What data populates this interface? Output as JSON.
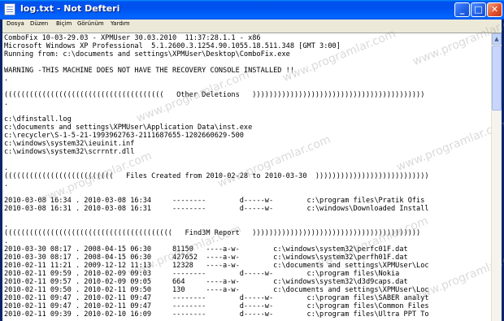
{
  "window": {
    "title": "log.txt - Not Defteri",
    "buttons": {
      "minimize": "_",
      "maximize": "□",
      "close": "✕"
    }
  },
  "menu": [
    "Dosya",
    "Düzen",
    "Biçim",
    "Görünüm",
    "Yardım"
  ],
  "watermark": "www.programlar.com",
  "lines": [
    "ComboFix 10-03-29.03 - XPMUser 30.03.2010  11:37:28.1.1 - x86",
    "Microsoft Windows XP Professional  5.1.2600.3.1254.90.1055.18.511.348 [GMT 3:00]",
    "Running from: c:\\documents and settings\\XPMUser\\Desktop\\ComboFix.exe",
    "",
    "WARNING -THIS MACHINE DOES NOT HAVE THE RECOVERY CONSOLE INSTALLED !!",
    ".",
    "",
    "((((((((((((((((((((((((((((((((((((((   Other Deletions   )))))))))))))))))))))))))))))))))))))))))",
    ".",
    "",
    "c:\\dfinstall.log",
    "c:\\documents and settings\\XPMUser\\Application Data\\inst.exe",
    "c:\\recycler\\S-1-5-21-1993962763-2111687655-1202660629-500",
    "c:\\windows\\system32\\ieuinit.inf",
    "c:\\windows\\system32\\scrrntr.dll",
    "",
    ".",
    "((((((((((((((((((((((((((   Files Created from 2010-02-28 to 2010-03-30  )))))))))))))))))))))))))))",
    ".",
    "",
    "2010-03-08 16:34 . 2010-03-08 16:34\t--------\td-----w-\tc:\\program files\\Pratik Ofis",
    "2010-03-08 16:31 . 2010-03-08 16:31\t--------\td-----w-\tc:\\windows\\Downloaded Install",
    "",
    ".",
    "((((((((((((((((((((((((((((((((((((((((   Find3M Report   ))))))))))))))))))))))))))))))))))))))))",
    ".",
    "2010-03-30 08:17 . 2008-04-15 06:30\t81150\t----a-w-\tc:\\windows\\system32\\perfc01F.dat",
    "2010-03-30 08:17 . 2008-04-15 06:30\t427652\t----a-w-\tc:\\windows\\system32\\perfh01F.dat",
    "2010-02-11 11:21 . 2009-12-12 11:13\t12328\t----a-w-\tc:\\documents and settings\\XPMUser\\Loc",
    "2010-02-11 09:59 . 2010-02-09 09:03\t--------\td-----w-\tc:\\program files\\Nokia",
    "2010-02-11 09:57 . 2010-02-09 09:05\t664\t----a-w-\tc:\\windows\\system32\\d3d9caps.dat",
    "2010-02-11 09:50 . 2010-02-11 09:50\t130\t----a-w-\tc:\\documents and settings\\XPMUser\\Loc",
    "2010-02-11 09:47 . 2010-02-11 09:47\t--------\td-----w-\tc:\\program files\\SABER analyt",
    "2010-02-11 09:47 . 2010-02-11 09:47\t--------\td-----w-\tc:\\program files\\Common Files",
    "2010-02-11 09:39 . 2010-02-10 16:09\t--------\td-----w-\tc:\\program files\\Ultra PPT To"
  ]
}
